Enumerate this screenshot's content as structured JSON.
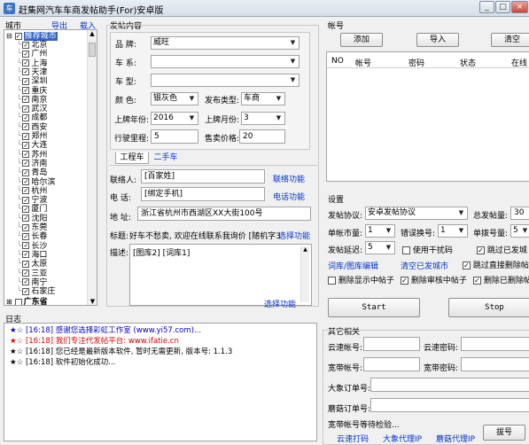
{
  "window": {
    "title": "赶集网汽车车商发帖助手(For)安卓版",
    "min_label": "_",
    "max_label": "□",
    "close_label": "×"
  },
  "city": {
    "label": "城市",
    "export_label": "导出",
    "import_label": "载入",
    "root": "推荐城市",
    "items": [
      "北京",
      "广州",
      "上海",
      "天津",
      "深圳",
      "重庆",
      "南京",
      "武汉",
      "成都",
      "西安",
      "郑州",
      "大连",
      "苏州",
      "济南",
      "青岛",
      "哈尔滨",
      "杭州",
      "宁波",
      "厦门",
      "沈阳",
      "东莞",
      "长春",
      "长沙",
      "海口",
      "太原",
      "三亚",
      "南宁",
      "石家庄"
    ],
    "group2": "广东省"
  },
  "post": {
    "label": "发帖内容",
    "brand_label": "品 牌:",
    "brand_value": "威旺",
    "series_label": "车 系:",
    "series_value": "",
    "model_label": "车 型:",
    "model_value": "",
    "color_label": "颜 色:",
    "color_value": "银灰色",
    "type_label": "发布类型:",
    "type_value": "车商",
    "year_label": "上牌年份:",
    "year_value": "2016",
    "month_label": "上牌月份:",
    "month_value": "3",
    "mileage_label": "行驶里程:",
    "mileage_value": "5",
    "price_label": "售卖价格:",
    "price_value": "20",
    "tab_engineering": "工程车",
    "tab_used": "二手车",
    "contact_label": "联络人:",
    "contact_value": "[百家姓]",
    "contact_link": "联络功能",
    "phone_label": "电 话:",
    "phone_value": "[绑定手机]",
    "phone_link": "电话功能",
    "address_label": "地 址:",
    "address_value": "浙江省杭州市西湖区XX大街100号",
    "title_label": "标题:",
    "title_value": "好车不愁卖, 欢迎在线联系我询价 [随机字3]",
    "title_link": "选择功能",
    "desc_label": "描述:",
    "desc_value": "[图库2] [词库1]",
    "desc_link": "选择功能"
  },
  "account": {
    "label": "帐号",
    "add": "添加",
    "import": "导入",
    "clear": "清空",
    "columns": [
      "NO",
      "帐号",
      "密码",
      "状态",
      "在线"
    ]
  },
  "settings": {
    "label": "设置",
    "protocol_label": "发帖协议:",
    "protocol_value": "安卓发帖协议",
    "total_label": "总发帖量:",
    "total_value": "30",
    "per_label": "单帐市量:",
    "per_value": "1",
    "err_label": "错误换号:",
    "err_value": "1",
    "dial_label": "单拨号量:",
    "dial_value": "5",
    "delay_label": "发帖延迟:",
    "delay_value": "5",
    "interfere_label": "使用干扰码",
    "skip_posted_label": "跳过已发城",
    "gallery_link": "词库/图库编辑",
    "sent_link": "清空已发城市",
    "skip_delete_label": "跳过直接删除帖",
    "del_show_label": "删除显示中帖子",
    "del_review_label": "删除审核中帖子",
    "del_deleted_label": "删除已删除帖",
    "start": "Start",
    "stop": "Stop"
  },
  "other": {
    "label": "其它相关",
    "cloud_acct_label": "云速帐号:",
    "cloud_pwd_label": "云速密码:",
    "wide_acct_label": "宽带帐号:",
    "wide_pwd_label": "宽带密码:",
    "dx_label": "大象订单号:",
    "mg_label": "蘑菇订单号:",
    "redial_label": "宽带帐号等待检验...",
    "cloud_link": "云速打码",
    "dx_link": "大象代理IP",
    "mg_link": "蘑菇代理IP",
    "dial_button": "拔号"
  },
  "log": {
    "label": "日志",
    "lines": [
      {
        "text": "★☆ [16:18] 感谢您选择彩虹工作室 (www.yi57.com)...",
        "color": "#0000cc"
      },
      {
        "text": "★☆ [16:18] 我们专注代发帖平台: www.ifatie.cn",
        "color": "#dd0000"
      },
      {
        "text": "★☆ [16:18] 您已经是最新版本软件, 暂时无需更新, 版本号: 1.1.3",
        "color": "#000000"
      },
      {
        "text": "★☆ [16:18] 软件初始化成功...",
        "color": "#000000"
      }
    ]
  }
}
